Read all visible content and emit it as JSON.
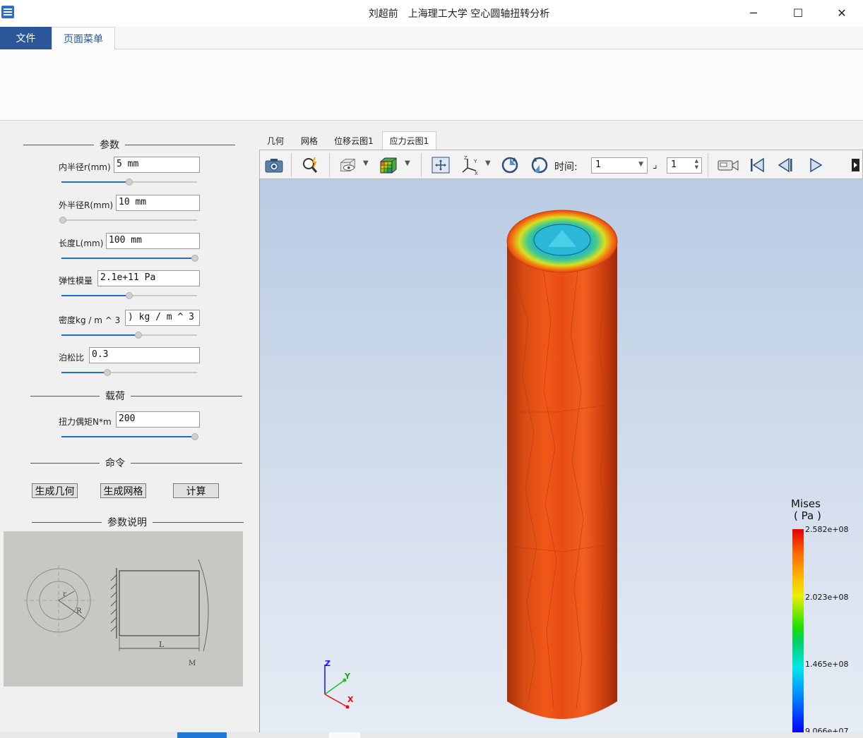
{
  "window": {
    "title": "刘超前　上海理工大学  空心圆轴扭转分析",
    "minimize": "─",
    "maximize": "☐",
    "close": "✕"
  },
  "ribbon": {
    "file_tab": "文件",
    "page_menu_tab": "页面菜单"
  },
  "params": {
    "group_title": "参数",
    "fields": [
      {
        "label": "内半径r(mm)",
        "value": "5 mm",
        "slider": 0.5
      },
      {
        "label": "外半径R(mm)",
        "value": "10 mm",
        "slider": 0.0
      },
      {
        "label": "长度L(mm)",
        "value": "100 mm",
        "slider": 1.0
      },
      {
        "label": "弹性模量",
        "value": "2.1e+11 Pa",
        "slider": 0.5
      },
      {
        "label": "密度kg / m ^ 3",
        "value": ") kg / m ^ 3",
        "slider": 0.57
      },
      {
        "label": "泊松比",
        "value": "0.3",
        "slider": 0.33
      }
    ]
  },
  "load": {
    "group_title": "载荷",
    "label": "扭力偶矩N*m",
    "value": "200",
    "slider": 1.0
  },
  "commands": {
    "group_title": "命令",
    "gen_geometry": "生成几何",
    "gen_mesh": "生成网格",
    "compute": "计算"
  },
  "explain": {
    "group_title": "参数说明",
    "sketch_labels": {
      "r": "r",
      "R": "R",
      "L": "L",
      "M": "M"
    }
  },
  "view_tabs": [
    "几何",
    "网格",
    "位移云图1",
    "应力云图1"
  ],
  "active_view_tab": 3,
  "toolbar": {
    "time_label": "时间:",
    "time_value": "1",
    "step_value": "1"
  },
  "icons": [
    "camera-icon",
    "zoom-icon",
    "display-mode-icon",
    "colormap-icon",
    "fit-view-icon",
    "axes-orientation-icon",
    "rotate-cw-icon",
    "rotate-ccw-icon",
    "record-video-icon",
    "first-frame-icon",
    "prev-frame-icon",
    "play-icon"
  ],
  "axes": {
    "z": "Z",
    "y": "Y",
    "x": "X"
  },
  "legend": {
    "title_line1": "Mises",
    "title_line2": "( Pa )",
    "labels": [
      "2.582e+08",
      "2.023e+08",
      "1.465e+08",
      "9.066e+07"
    ]
  },
  "colors": {
    "accent": "#2b579a",
    "slider_fill": "#1e6fd0"
  }
}
